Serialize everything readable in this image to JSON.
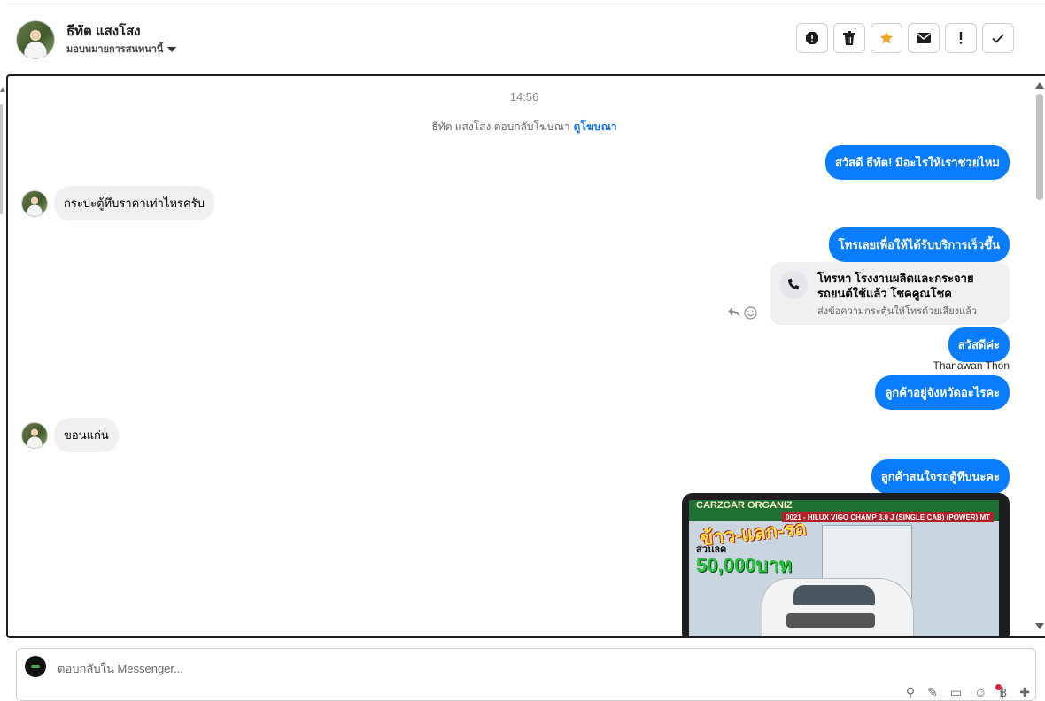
{
  "header": {
    "contact_name": "ธีทัต แสงโสง",
    "assign_label": "มอบหมายการสนทนานี้",
    "actions": [
      {
        "name": "report-spam-icon",
        "label": "spam"
      },
      {
        "name": "trash-icon",
        "label": "delete"
      },
      {
        "name": "star-icon",
        "label": "star"
      },
      {
        "name": "mail-icon",
        "label": "mark unread"
      },
      {
        "name": "exclamation-icon",
        "label": "follow up"
      },
      {
        "name": "check-icon",
        "label": "done"
      }
    ],
    "star_color": "#f5a623"
  },
  "chat": {
    "timestamp": "14:56",
    "ad_reply_text": "ธีทัต แสงโสง ตอบกลับโฆษณา",
    "ad_reply_link": "ดูโฆษณา",
    "messages": [
      {
        "dir": "out",
        "text": "สวัสดี ธีทัต! มีอะไรให้เราช่วยไหม"
      },
      {
        "dir": "in",
        "text": "กระบะตู้ทึบราคาเท่าไหร่ครับ"
      },
      {
        "dir": "out",
        "text": "โทรเลยเพื่อให้ได้รับบริการเร็วขึ้น"
      },
      {
        "dir": "out",
        "text": "สวัสดีค่ะ"
      },
      {
        "dir": "out",
        "text": "ลูกค้าอยู่จังหวัดอะไรคะ"
      },
      {
        "dir": "in",
        "text": "ขอนแก่น"
      },
      {
        "dir": "out",
        "text": "ลูกค้าสนใจรถตู้ทึบนะคะ"
      }
    ],
    "call_card": {
      "title": "โทรหา โรงงานผลิตและกระจายรถยนต์ใช้แล้ว โชคคูณโชค",
      "subtitle": "ส่งข้อความกระตุ้นให้โทรด้วยเสียงแล้ว"
    },
    "sender_label": "Thanawan Thon",
    "image": {
      "banner_text": "CARZGAR ORGANIZ",
      "model_text": "0021 - HILUX VIGO CHAMP 3.0 J (SINGLE CAB) (POWER) MT",
      "promo_line1": "ข้าว-แลก-รถ",
      "promo_line2": "ส่วนลด",
      "promo_line3": "50,000บาท"
    },
    "accent_color": "#0a7cff"
  },
  "composer": {
    "placeholder": "ตอบกลับใน Messenger..."
  }
}
